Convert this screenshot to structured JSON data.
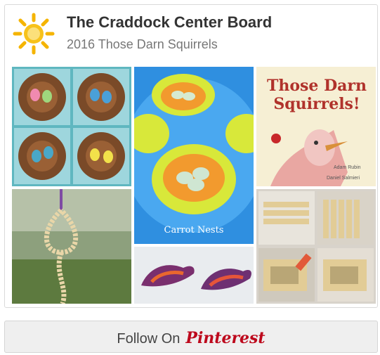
{
  "board": {
    "title": "The Craddock Center Board",
    "subtitle": "2016 Those Darn Squirrels",
    "logo_icon": "sun-logo-icon"
  },
  "pins": [
    {
      "name": "bird-nests-craft",
      "icon": "nest-eggs-image"
    },
    {
      "name": "carrot-nests-snack",
      "caption": "Carrot Nests"
    },
    {
      "name": "those-darn-squirrels-book",
      "book_title": "Those Darn Squirrels!",
      "author": "Adam Rubin",
      "illustrator": "Daniel Salmieri"
    },
    {
      "name": "cheerio-bird-feeder",
      "icon": "feeder-image"
    },
    {
      "name": "painted-birds-craft",
      "icon": "birds-image"
    },
    {
      "name": "popsicle-stick-birdhouse",
      "icon": "craft-sticks-image"
    }
  ],
  "follow": {
    "label": "Follow On",
    "brand": "Pinterest"
  },
  "colors": {
    "brand": "#bd081c",
    "title": "#333333",
    "subtitle": "#777777"
  }
}
